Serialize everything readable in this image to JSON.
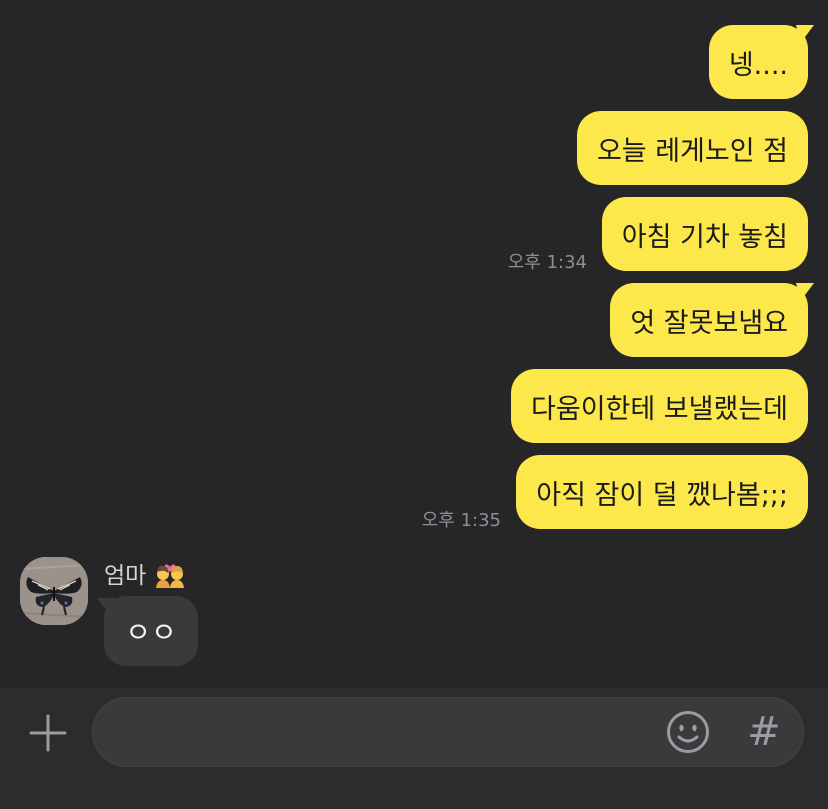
{
  "messages_out": [
    {
      "text": "넹...."
    },
    {
      "text": "오늘 레게노인 점"
    },
    {
      "text": "아침 기차 놓침",
      "time": "오후 1:34"
    },
    {
      "text": "엇 잘못보냄요"
    },
    {
      "text": "다움이한테 보낼랬는데"
    },
    {
      "text": "아직 잠이 덜 깼나봄;;;",
      "time": "오후 1:35"
    }
  ],
  "incoming": {
    "sender_name": "엄마",
    "sender_emoji": "couple-with-heart-emoji",
    "avatar": "butterfly-photo",
    "text": "ㅇㅇ"
  },
  "input_bar": {
    "placeholder": "",
    "value": "",
    "left_button_icon": "plus-icon",
    "emoji_button_icon": "smiley-icon",
    "hash_button": "#"
  },
  "colors": {
    "background": "#262628",
    "outgoing_bubble": "#FCE84A",
    "incoming_bubble": "#3a3a3c",
    "timestamp": "#8e8e93"
  }
}
